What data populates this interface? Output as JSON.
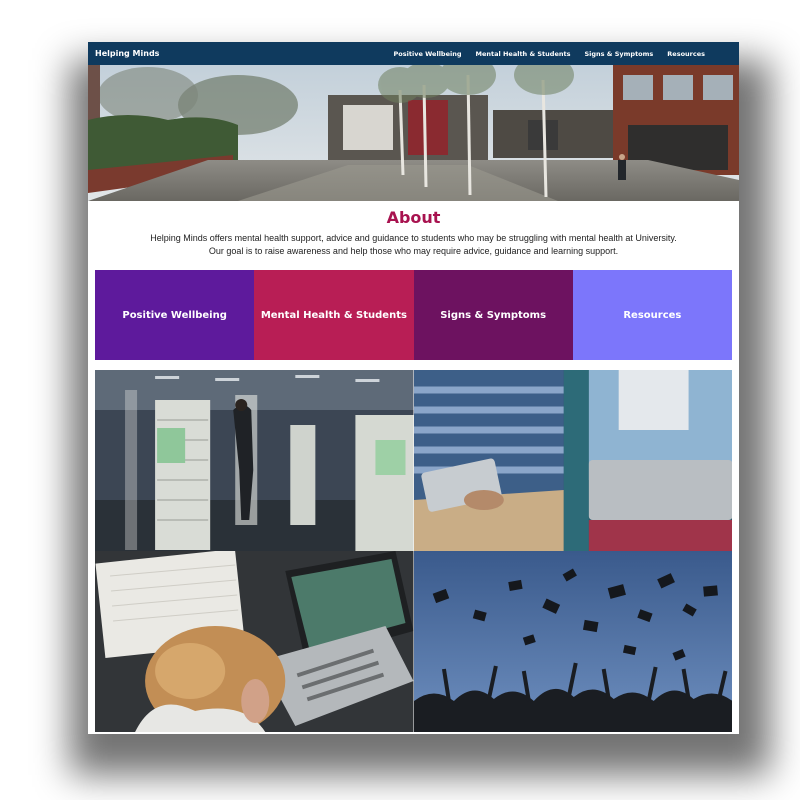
{
  "site": {
    "brand": "Helping Minds"
  },
  "nav": {
    "links": [
      "Positive Wellbeing",
      "Mental Health & Students",
      "Signs & Symptoms",
      "Resources"
    ]
  },
  "about": {
    "title": "About",
    "line1": "Helping Minds offers mental health support, advice and guidance to students who may be struggling with mental health at University.",
    "line2": "Our goal is to raise awareness and help those who may require advice, guidance and learning support."
  },
  "tiles": [
    {
      "label": "Positive Wellbeing",
      "color": "#5e1a9c"
    },
    {
      "label": "Mental Health & Students",
      "color": "#b81e55"
    },
    {
      "label": "Signs & Symptoms",
      "color": "#6d1260"
    },
    {
      "label": "Resources",
      "color": "#7c76fb"
    }
  ],
  "colors": {
    "navbar": "#0f3a5e",
    "about_title": "#a8124f"
  },
  "photos": [
    "campus-hero-photo",
    "library-photo",
    "students-laptop-photo",
    "stressed-student-photo",
    "graduation-photo"
  ]
}
